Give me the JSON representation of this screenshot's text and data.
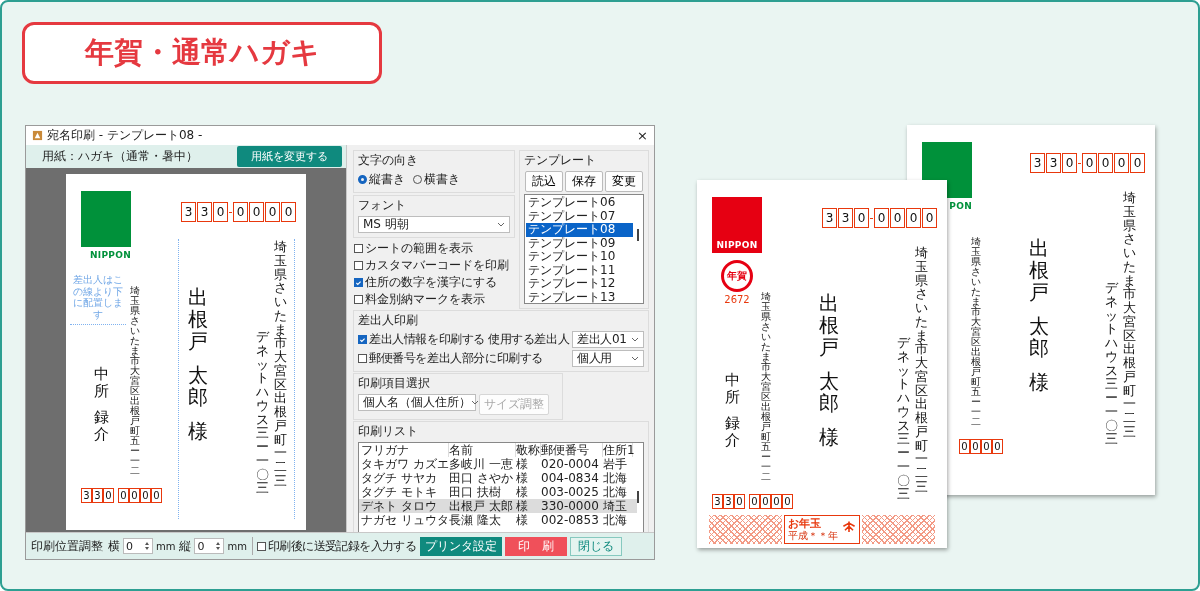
{
  "banner": {
    "title": "年賀・通常ハガキ"
  },
  "dialog": {
    "title": "宛名印刷 - テンプレート08 -",
    "close": "×",
    "paper_label": "用紙：ハガキ（通常・暑中）",
    "change_paper_button": "用紙を変更する",
    "preview": {
      "kind": "normal",
      "logo_text": "NIPPON",
      "postal_code": [
        [
          "3",
          "3",
          "0"
        ],
        [
          "0",
          "0",
          "0",
          "0"
        ]
      ],
      "address": [
        "埼玉県さいたま市大宮区出根戸町一二三",
        "デネットハウス三ー一〇三"
      ],
      "name_parts": [
        "出根戸",
        "太郎"
      ],
      "honorific": "様",
      "sender_address": "埼玉県さいたま市大宮区出根戸町五ー一二",
      "sender_name": [
        "中所",
        "録介"
      ],
      "sender_postal_code": [
        [
          "3",
          "3",
          "0"
        ],
        [
          "0",
          "0",
          "0",
          "0"
        ]
      ]
    },
    "preview_guide": "差出人はこの線より下に配置します",
    "direction": {
      "label": "文字の向き",
      "options": [
        {
          "label": "縦書き",
          "selected": true
        },
        {
          "label": "横書き",
          "selected": false
        }
      ]
    },
    "font": {
      "label": "フォント",
      "value": "MS 明朝"
    },
    "options": [
      {
        "label": "シートの範囲を表示",
        "checked": false
      },
      {
        "label": "カスタマバーコードを印刷",
        "checked": false
      },
      {
        "label": "住所の数字を漢字にする",
        "checked": true
      },
      {
        "label": "料金別納マークを表示",
        "checked": false
      }
    ],
    "template": {
      "label": "テンプレート",
      "buttons": [
        "読込",
        "保存",
        "変更"
      ],
      "items": [
        {
          "label": "テンプレート06",
          "selected": false
        },
        {
          "label": "テンプレート07",
          "selected": false
        },
        {
          "label": "テンプレート08",
          "selected": true
        },
        {
          "label": "テンプレート09",
          "selected": false
        },
        {
          "label": "テンプレート10",
          "selected": false
        },
        {
          "label": "テンプレート11",
          "selected": false
        },
        {
          "label": "テンプレート12",
          "selected": false
        },
        {
          "label": "テンプレート13",
          "selected": false
        }
      ]
    },
    "sender": {
      "label": "差出人印刷",
      "select_label": "使用する差出人",
      "rows": [
        {
          "label": "差出人情報を印刷する",
          "checked": true,
          "value": "差出人01"
        },
        {
          "label": "郵便番号を差出人部分に印刷する",
          "checked": false,
          "value": "個人用"
        }
      ]
    },
    "print_item": {
      "label": "印刷項目選択",
      "value": "個人名（個人住所）",
      "size_button": {
        "label": "サイズ調整",
        "disabled": true
      }
    },
    "print_list": {
      "label": "印刷リスト",
      "columns": [
        "フリガナ",
        "名前",
        "敬称",
        "郵便番号",
        "住所1"
      ],
      "rows": [
        {
          "cells": [
            "タキガワ カズエ",
            "多岐川 一恵",
            "様",
            "020-0004",
            "岩手"
          ],
          "selected": false
        },
        {
          "cells": [
            "タグチ サヤカ",
            "田口 さやか",
            "様",
            "004-0834",
            "北海"
          ],
          "selected": false
        },
        {
          "cells": [
            "タグチ モトキ",
            "田口 扶樹",
            "様",
            "003-0025",
            "北海"
          ],
          "selected": false
        },
        {
          "cells": [
            "デネト タロウ",
            "出根戸 太郎",
            "様",
            "330-0000",
            "埼玉"
          ],
          "selected": true
        },
        {
          "cells": [
            "ナガセ リュウタ",
            "長瀬 隆太",
            "様",
            "002-0853",
            "北海"
          ],
          "selected": false
        }
      ]
    },
    "footer": {
      "label": "印刷位置調整",
      "x_label": "横",
      "x_value": "0",
      "x_unit": "mm",
      "y_label": "縦",
      "y_value": "0",
      "y_unit": "mm",
      "record": {
        "label": "印刷後に送受記録を入力する",
        "checked": false
      },
      "buttons": [
        {
          "kind": "printer",
          "label": "プリンタ設定"
        },
        {
          "kind": "print",
          "label": "印　刷"
        },
        {
          "kind": "close",
          "label": "閉じる"
        }
      ]
    }
  },
  "postcards": [
    {
      "kind": "normal",
      "logo_text": "PON",
      "postal_code": [
        [
          "3",
          "3",
          "0"
        ],
        [
          "0",
          "0",
          "0",
          "0"
        ]
      ],
      "address": [
        "埼玉県さいたま市大宮区出根戸町一二三",
        "デネットハウス三ー一〇三"
      ],
      "name_parts": [
        "出根戸",
        "太郎"
      ],
      "honorific": "様",
      "sender_address": "埼玉県さいたま市大宮区出根戸町五ー一二",
      "sender_postal_code": [
        [
          "0",
          "0",
          "0",
          "0"
        ]
      ]
    },
    {
      "kind": "nenga",
      "logo_text": "NIPPON",
      "mark": {
        "text": "年賀",
        "number": "2672"
      },
      "postal_code": [
        [
          "3",
          "3",
          "0"
        ],
        [
          "0",
          "0",
          "0",
          "0"
        ]
      ],
      "address": [
        "埼玉県さいたま市大宮区出根戸町一二三",
        "デネットハウス三ー一〇三"
      ],
      "name_parts": [
        "出根戸",
        "太郎"
      ],
      "honorific": "様",
      "sender_address": "埼玉県さいたま市大宮区出根戸町五ー一二",
      "sender_name": [
        "中所",
        "録介"
      ],
      "sender_postal_code": [
        [
          "3",
          "3",
          "0"
        ],
        [
          "0",
          "0",
          "0",
          "0"
        ]
      ],
      "lottery": {
        "title": "お年玉",
        "era": "平成＊＊年"
      }
    }
  ]
}
